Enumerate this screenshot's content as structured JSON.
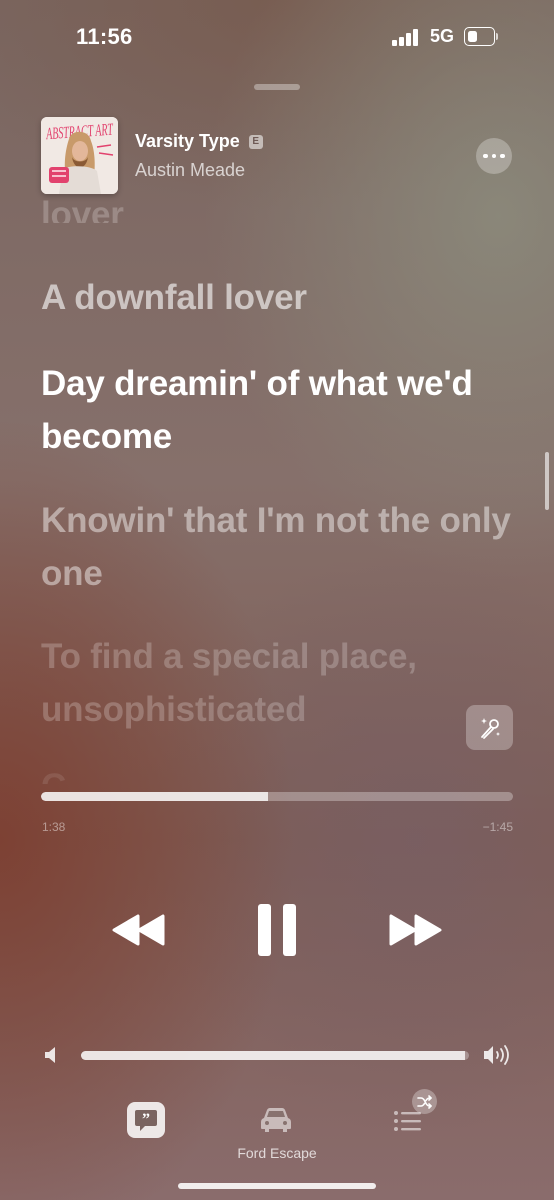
{
  "status_bar": {
    "time": "11:56",
    "network": "5G",
    "battery_level": 0.45
  },
  "now_playing": {
    "title": "Varsity Type",
    "explicit_badge": "E",
    "artist": "Austin Meade",
    "artwork_text": "ABSTRACT ART"
  },
  "lyrics": {
    "previous": "lover",
    "past": "A downfall lover",
    "current": "Day dreamin' of what we'd become",
    "upcoming": [
      "Knowin' that I'm not the only one",
      "To find a special place, unsophisticated",
      "C"
    ]
  },
  "playback": {
    "elapsed": "1:38",
    "remaining": "−1:45",
    "progress": 0.48
  },
  "volume": {
    "level": 0.99
  },
  "toolbar": {
    "output_device": "Ford Escape"
  },
  "icons": {
    "more": "ellipsis-icon",
    "sing": "microphone-sparkle-icon",
    "prev": "backward-icon",
    "pause": "pause-icon",
    "next": "forward-icon",
    "volume_low": "speaker-low-icon",
    "volume_high": "speaker-high-icon",
    "lyrics": "quote-bubble-icon",
    "car": "car-icon",
    "queue": "list-icon",
    "shuffle": "shuffle-icon"
  },
  "colors": {
    "explicit_text": "#6e5a55",
    "artwork_pink": "#e2426e"
  }
}
